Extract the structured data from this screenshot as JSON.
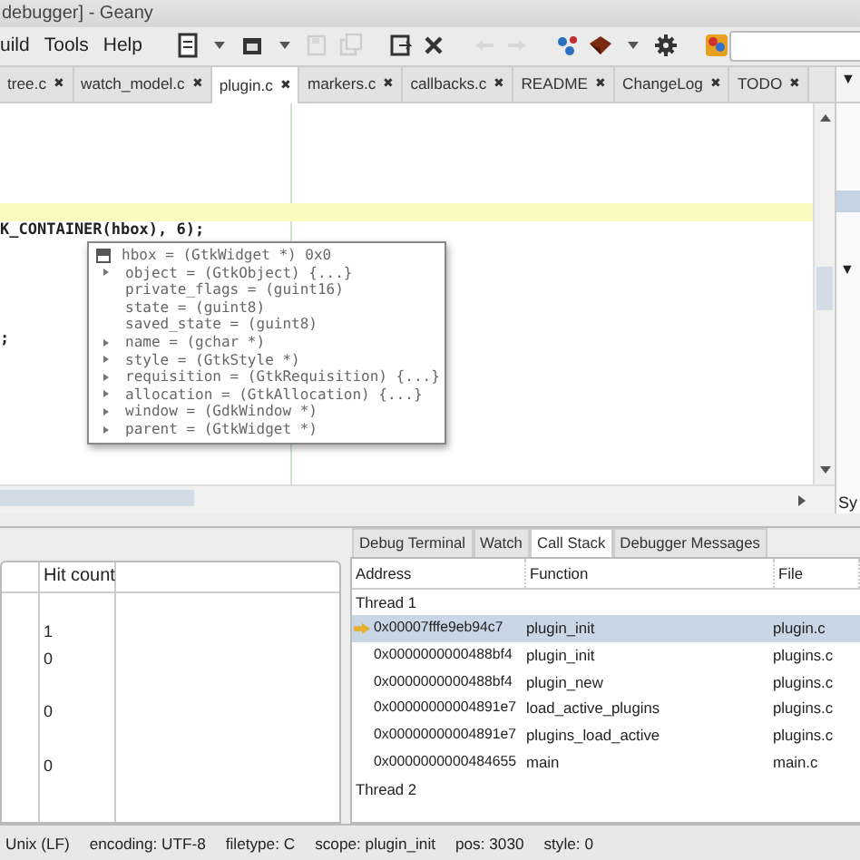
{
  "window": {
    "title": "debugger] - Geany"
  },
  "menu": [
    {
      "label": "uild"
    },
    {
      "label": "Tools"
    },
    {
      "label": "Help"
    }
  ],
  "toolbar": [
    [
      {
        "kind": "new",
        "disabled": false
      },
      {
        "kind": "dropdown",
        "disabled": false
      },
      {
        "kind": "open",
        "disabled": false
      },
      {
        "kind": "dropdown",
        "disabled": false
      },
      {
        "kind": "save",
        "disabled": true
      },
      {
        "kind": "saveall",
        "disabled": true
      }
    ],
    [
      {
        "kind": "reload",
        "disabled": false
      },
      {
        "kind": "close",
        "disabled": false
      }
    ],
    [
      {
        "kind": "back",
        "disabled": true
      },
      {
        "kind": "forward",
        "disabled": true
      }
    ],
    [
      {
        "kind": "compile",
        "disabled": false
      },
      {
        "kind": "build",
        "disabled": false
      },
      {
        "kind": "dropdown",
        "disabled": false
      },
      {
        "kind": "run",
        "disabled": false
      }
    ],
    [
      {
        "kind": "color",
        "disabled": false
      }
    ]
  ],
  "tabs": [
    {
      "label": "tree.c",
      "close": "✖",
      "selected": false
    },
    {
      "label": "watch_model.c",
      "close": "✖",
      "selected": false
    },
    {
      "label": "plugin.c",
      "close": "✖",
      "selected": true
    },
    {
      "label": "markers.c",
      "close": "✖",
      "selected": false
    },
    {
      "label": "callbacks.c",
      "close": "✖",
      "selected": false
    },
    {
      "label": "README",
      "close": "✖",
      "selected": false
    },
    {
      "label": "ChangeLog",
      "close": "✖",
      "selected": false
    },
    {
      "label": "TODO",
      "close": "✖",
      "selected": false
    }
  ],
  "side_panel": {
    "top_glyph": "▼",
    "mid_glyph": "▼",
    "label": "Sy"
  },
  "editor": {
    "lines": [
      {
        "current": false
      },
      {
        "current": false
      },
      {
        "current": false
      },
      {
        "current": false
      },
      {
        "current": false
      },
      {
        "current": true
      },
      {
        "text": "K_CONTAINER(hbox), 6);",
        "current": false
      },
      {
        "current": false
      },
      {
        "current": false
      },
      {
        "current": false
      },
      {
        "current": false
      },
      {
        "current": false
      },
      {
        "text": ";",
        "current": false
      }
    ],
    "tooltip": {
      "title": "hbox = (GtkWidget *) 0x0",
      "fields": [
        {
          "text": "object = (GtkObject) {...}",
          "expandable": true
        },
        {
          "text": "private_flags = (guint16)",
          "expandable": false
        },
        {
          "text": "state = (guint8)",
          "expandable": false
        },
        {
          "text": "saved_state = (guint8)",
          "expandable": false
        },
        {
          "text": "name = (gchar *)",
          "expandable": true
        },
        {
          "text": "style = (GtkStyle *)",
          "expandable": true
        },
        {
          "text": "requisition = (GtkRequisition) {...}",
          "expandable": true
        },
        {
          "text": "allocation = (GtkAllocation) {...}",
          "expandable": true
        },
        {
          "text": "window = (GdkWindow *)",
          "expandable": true
        },
        {
          "text": "parent = (GtkWidget *)",
          "expandable": true
        }
      ]
    }
  },
  "breakpoints": {
    "columns": [
      "Hit count"
    ],
    "rows": [
      {},
      {
        "hit_count": "1"
      },
      {
        "hit_count": "0"
      },
      {},
      {
        "hit_count": "0"
      },
      {},
      {
        "hit_count": "0"
      }
    ]
  },
  "debug_tabs": [
    {
      "label": "Debug Terminal",
      "selected": false
    },
    {
      "label": "Watch",
      "selected": false
    },
    {
      "label": "Call Stack",
      "selected": true
    },
    {
      "label": "Debugger Messages",
      "selected": false
    }
  ],
  "call_stack": {
    "columns": [
      "Address",
      "Function",
      "File"
    ],
    "rows": [
      {
        "kind": "thread",
        "label": "Thread 1"
      },
      {
        "kind": "frame",
        "address": "0x00007fffe9eb94c7",
        "function": "plugin_init",
        "file": "plugin.c",
        "selected": true,
        "current": true
      },
      {
        "kind": "frame",
        "address": "0x0000000000488bf4",
        "function": "plugin_init",
        "file": "plugins.c",
        "selected": false,
        "current": false
      },
      {
        "kind": "frame",
        "address": "0x0000000000488bf4",
        "function": "plugin_new",
        "file": "plugins.c",
        "selected": false,
        "current": false
      },
      {
        "kind": "frame",
        "address": "0x00000000004891e7",
        "function": "load_active_plugins",
        "file": "plugins.c",
        "selected": false,
        "current": false
      },
      {
        "kind": "frame",
        "address": "0x00000000004891e7",
        "function": "plugins_load_active",
        "file": "plugins.c",
        "selected": false,
        "current": false
      },
      {
        "kind": "frame",
        "address": "0x0000000000484655",
        "function": "main",
        "file": "main.c",
        "selected": false,
        "current": false
      },
      {
        "kind": "thread",
        "label": "Thread 2"
      }
    ]
  },
  "status_bar": [
    "Unix (LF)",
    "encoding: UTF-8",
    "filetype: C",
    "scope: plugin_init",
    "pos: 3030",
    "style: 0"
  ]
}
